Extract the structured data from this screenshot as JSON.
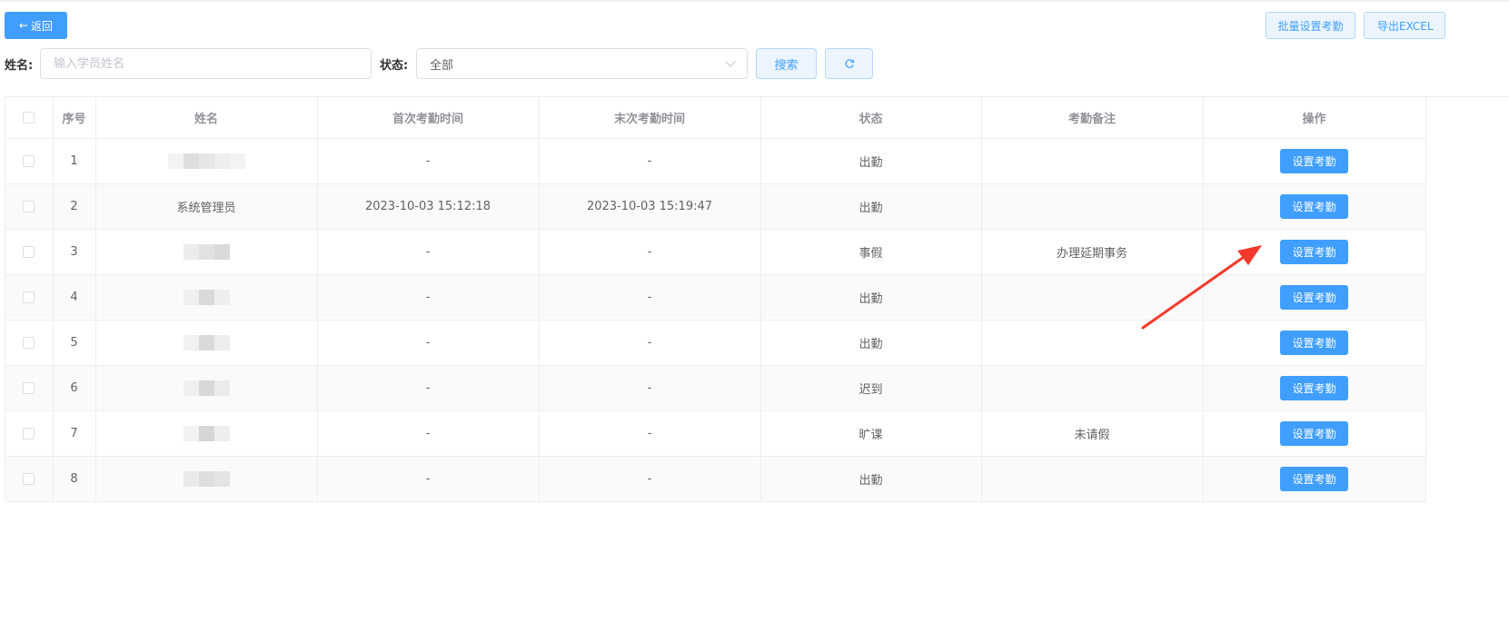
{
  "toolbar": {
    "back_label": "返回",
    "back_icon": "arrow-left-icon",
    "batch_label": "批量设置考勤",
    "export_label": "导出EXCEL"
  },
  "filters": {
    "name_label": "姓名:",
    "name_placeholder": "输入学员姓名",
    "name_value": "",
    "status_label": "状态:",
    "status_value": "全部",
    "search_label": "搜索",
    "refresh_icon": "refresh-icon"
  },
  "table": {
    "headers": [
      "",
      "序号",
      "姓名",
      "首次考勤时间",
      "末次考勤时间",
      "状态",
      "考勤备注",
      "操作"
    ],
    "rows": [
      {
        "index": "1",
        "name": "",
        "first": "-",
        "last": "-",
        "status": "出勤",
        "note": "",
        "action": "设置考勤"
      },
      {
        "index": "2",
        "name": "系统管理员",
        "first": "2023-10-03 15:12:18",
        "last": "2023-10-03 15:19:47",
        "status": "出勤",
        "note": "",
        "action": "设置考勤"
      },
      {
        "index": "3",
        "name": "",
        "first": "-",
        "last": "-",
        "status": "事假",
        "note": "办理延期事务",
        "action": "设置考勤"
      },
      {
        "index": "4",
        "name": "",
        "first": "-",
        "last": "-",
        "status": "出勤",
        "note": "",
        "action": "设置考勤"
      },
      {
        "index": "5",
        "name": "",
        "first": "-",
        "last": "-",
        "status": "出勤",
        "note": "",
        "action": "设置考勤"
      },
      {
        "index": "6",
        "name": "",
        "first": "-",
        "last": "-",
        "status": "迟到",
        "note": "",
        "action": "设置考勤"
      },
      {
        "index": "7",
        "name": "",
        "first": "-",
        "last": "-",
        "status": "旷课",
        "note": "未请假",
        "action": "设置考勤"
      },
      {
        "index": "8",
        "name": "",
        "first": "-",
        "last": "-",
        "status": "出勤",
        "note": "",
        "action": "设置考勤"
      }
    ]
  },
  "colors": {
    "primary": "#409eff",
    "annotation_arrow": "#f23a2c"
  }
}
